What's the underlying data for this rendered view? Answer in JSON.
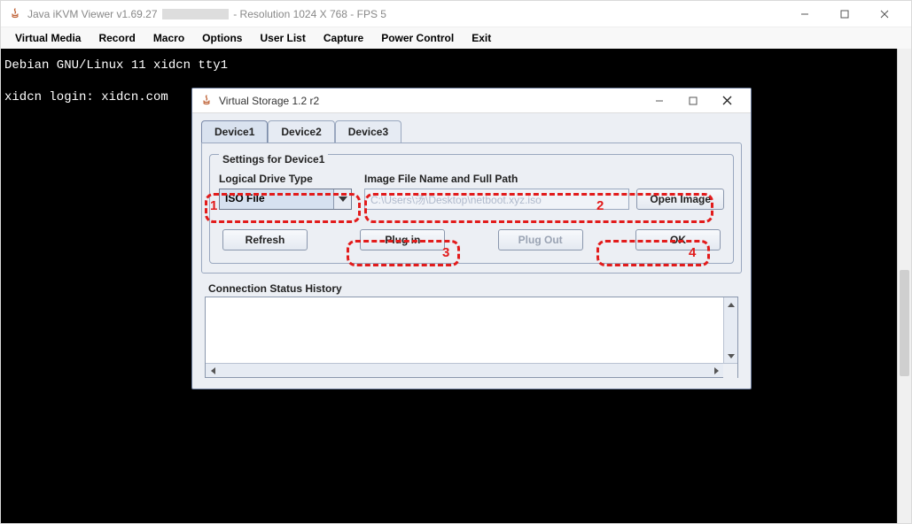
{
  "outer_window": {
    "title_prefix": "Java iKVM Viewer v1.69.27",
    "title_suffix": " - Resolution 1024 X 768 - FPS 5"
  },
  "menu": {
    "items": [
      "Virtual Media",
      "Record",
      "Macro",
      "Options",
      "User List",
      "Capture",
      "Power Control",
      "Exit"
    ]
  },
  "terminal": {
    "line1": "Debian GNU/Linux 11 xidcn tty1",
    "line2": "",
    "line3": "xidcn login: xidcn.com"
  },
  "dialog": {
    "title": "Virtual Storage 1.2 r2",
    "tabs": [
      "Device1",
      "Device2",
      "Device3"
    ],
    "active_tab": 0,
    "fieldset_legend": "Settings for Device1",
    "drive_type_label": "Logical Drive Type",
    "drive_type_value": "ISO File",
    "path_label": "Image File Name and Full Path",
    "path_value": "C:\\Users\\汤\\Desktop\\netboot.xyz.iso",
    "open_image_label": "Open Image",
    "buttons": {
      "refresh": "Refresh",
      "plug_in": "Plug in",
      "plug_out": "Plug Out",
      "ok": "OK"
    },
    "status_label": "Connection Status History"
  },
  "annotations": {
    "n1": "1",
    "n2": "2",
    "n3": "3",
    "n4": "4"
  }
}
